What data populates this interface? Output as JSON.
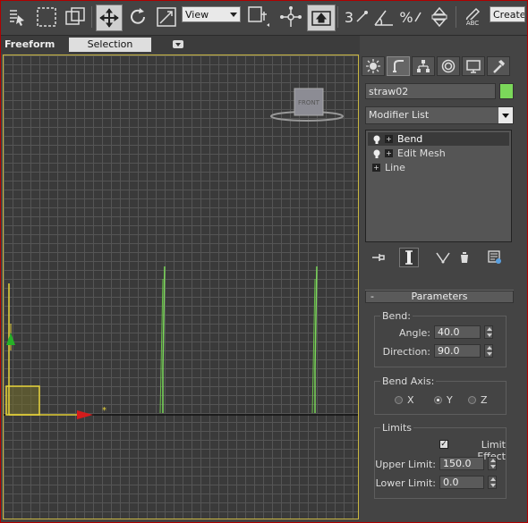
{
  "toolbar": {
    "view_dropdown": "View",
    "snap_label": "3",
    "percent_label": "%",
    "create_dropdown": "Create",
    "spell_label": "ABC"
  },
  "ribbon": {
    "title": "Freeform",
    "selection_tab": "Selection"
  },
  "viewport": {
    "label": "",
    "viewcube_label": "FRONT"
  },
  "panel": {
    "object_name": "straw02",
    "object_color": "#7bd85a",
    "modifier_list": "Modifier List",
    "stack": [
      {
        "label": "Bend",
        "selected": true,
        "bulb": true
      },
      {
        "label": "Edit Mesh",
        "selected": false,
        "bulb": true
      },
      {
        "label": "Line",
        "selected": false,
        "bulb": false
      }
    ],
    "rollout_title": "Parameters",
    "bend": {
      "title": "Bend:",
      "angle_label": "Angle:",
      "angle_value": "40.0",
      "direction_label": "Direction:",
      "direction_value": "90.0"
    },
    "bend_axis": {
      "title": "Bend Axis:",
      "x": "X",
      "y": "Y",
      "z": "Z",
      "selected": "Y"
    },
    "limits": {
      "title": "Limits",
      "limit_effect_label": "Limit Effect",
      "limit_effect_checked": true,
      "upper_label": "Upper Limit:",
      "upper_value": "150.0",
      "lower_label": "Lower Limit:",
      "lower_value": "0.0"
    }
  }
}
